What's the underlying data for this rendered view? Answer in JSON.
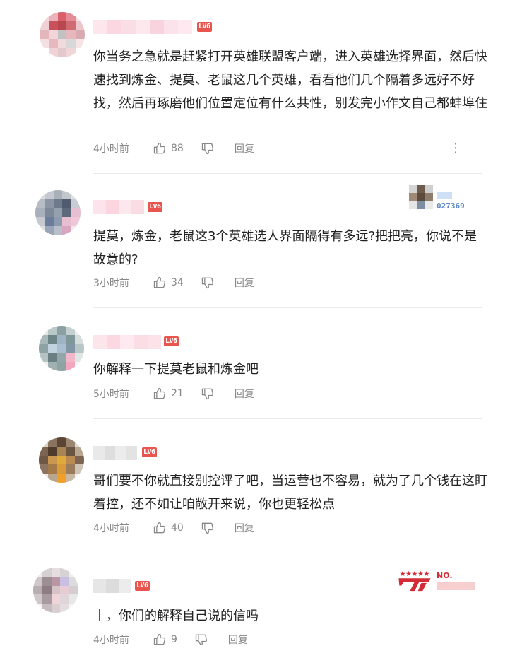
{
  "labels": {
    "reply": "回复",
    "level": "LV6"
  },
  "comments": [
    {
      "text": "你当务之急就是赶紧打开英雄联盟客户端，进入英雄选择界面，然后快速找到炼金、提莫、老鼠这几个英雄，看看他们几个隔着多远好不好找，然后再琢磨他们位置定位有什么共性，别发完小作文自己都蚌埠住",
      "time": "4小时前",
      "likes": "88",
      "more": "⋮"
    },
    {
      "text": "提莫，炼金，老鼠这3个英雄选人界面隔得有多远?把把亮，你说不是故意的?",
      "time": "3小时前",
      "likes": "34",
      "badge_number": "027369"
    },
    {
      "text": "你解释一下提莫老鼠和炼金吧",
      "time": "5小时前",
      "likes": "21"
    },
    {
      "text": "哥们要不你就直接别控评了吧，当运营也不容易，就为了几个钱在这盯着控，还不如让咱敞开来说，你也更轻松点",
      "time": "4小时前",
      "likes": "40"
    },
    {
      "text": "丨，你们的解释自己说的信吗",
      "time": "4小时前",
      "likes": "9",
      "badge_no": "NO."
    }
  ],
  "colors": {
    "level_badge": "#e8554e",
    "text": "#222222",
    "meta": "#888888",
    "divider": "#eaeaea",
    "t1_red": "#d42c36",
    "badge_blue": "#5a86c9"
  }
}
